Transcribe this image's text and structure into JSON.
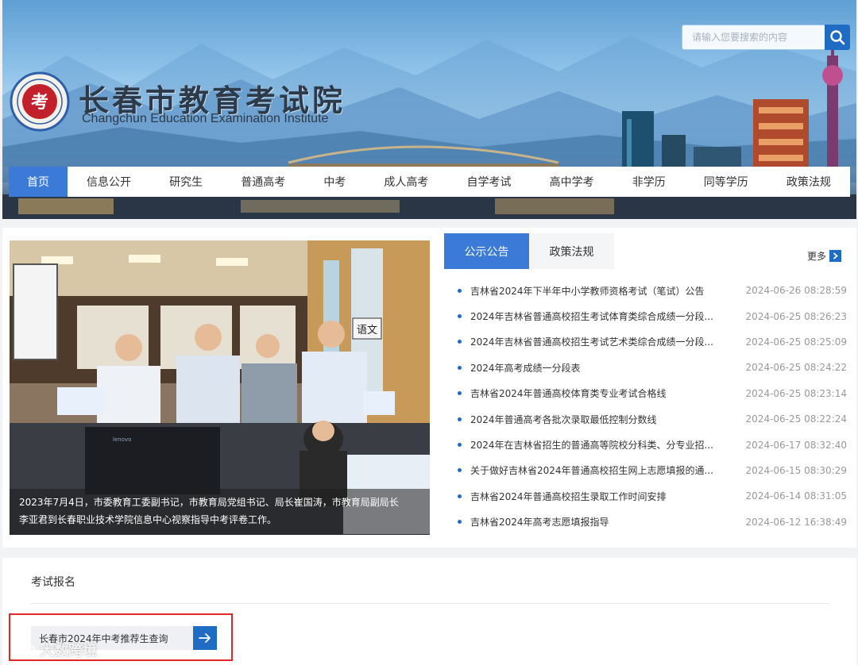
{
  "header": {
    "site_title": "长春市教育考试院",
    "site_title_en": "Changchun Education Examination Institute",
    "emblem_text": "考"
  },
  "search": {
    "placeholder": "请输入您要搜索的内容",
    "icon": "search-icon"
  },
  "nav": {
    "items": [
      {
        "label": "首页",
        "active": true
      },
      {
        "label": "信息公开"
      },
      {
        "label": "研究生"
      },
      {
        "label": "普通高考"
      },
      {
        "label": "中考"
      },
      {
        "label": "成人高考"
      },
      {
        "label": "自学考试"
      },
      {
        "label": "高中学考"
      },
      {
        "label": "非学历"
      },
      {
        "label": "同等学历"
      },
      {
        "label": "政策法规"
      }
    ]
  },
  "feature": {
    "caption_line1": "2023年7月4日，市委教育工委副书记，市教育局党组书记、局长崔国涛，市教育局副局长",
    "caption_line2": "李亚君到长春职业技术学院信息中心视察指导中考评卷工作。",
    "sign_text": "语文",
    "monitor_brand": "lenovo"
  },
  "notices": {
    "tabs": [
      {
        "label": "公示公告",
        "active": true
      },
      {
        "label": "政策法规"
      }
    ],
    "more_label": "更多",
    "items": [
      {
        "title": "吉林省2024年下半年中小学教师资格考试（笔试）公告",
        "date": "2024-06-26 08:28:59"
      },
      {
        "title": "2024年吉林省普通高校招生考试体育类综合成绩一分段...",
        "date": "2024-06-25 08:26:23"
      },
      {
        "title": "2024年吉林省普通高校招生考试艺术类综合成绩一分段...",
        "date": "2024-06-25 08:25:09"
      },
      {
        "title": "2024年高考成绩一分段表",
        "date": "2024-06-25 08:24:22"
      },
      {
        "title": "吉林省2024年普通高校体育类专业考试合格线",
        "date": "2024-06-25 08:23:14"
      },
      {
        "title": "2024年普通高考各批次录取最低控制分数线",
        "date": "2024-06-25 08:22:24"
      },
      {
        "title": "2024年在吉林省招生的普通高等院校分科类、分专业招...",
        "date": "2024-06-17 08:32:40"
      },
      {
        "title": "关于做好吉林省2024年普通高校招生网上志愿填报的通...",
        "date": "2024-06-15 08:30:29"
      },
      {
        "title": "吉林省2024年普通高校招生录取工作时间安排",
        "date": "2024-06-14 08:31:05"
      },
      {
        "title": "吉林省2024年高考志愿填报指导",
        "date": "2024-06-12 16:38:49"
      }
    ]
  },
  "exam": {
    "section_title": "考试报名",
    "link_label": "长春市2024年中考推荐生查询"
  },
  "watermark": {
    "text": "大数跨境"
  },
  "colors": {
    "accent": "#3b7ad6",
    "dark_blue": "#1e6cc4",
    "highlight": "#e02828"
  }
}
